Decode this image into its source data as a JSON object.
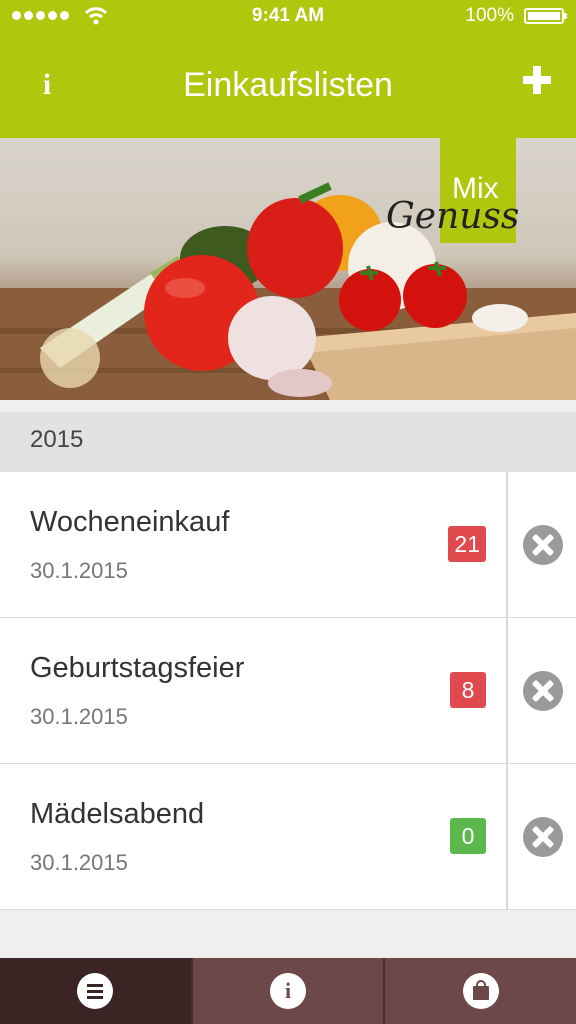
{
  "status_bar": {
    "time": "9:41 AM",
    "battery": "100%",
    "signal_icon": "signal-dots-icon",
    "wifi_icon": "wifi-icon",
    "battery_icon": "battery-icon"
  },
  "nav": {
    "title": "Einkaufslisten",
    "info_glyph": "i",
    "info_icon": "info-icon",
    "add_icon": "plus-icon"
  },
  "banner": {
    "logo_mix": "Mix",
    "logo_genuss": "Genuss"
  },
  "section": {
    "year": "2015"
  },
  "lists": [
    {
      "title": "Wocheneinkauf",
      "date": "30.1.2015",
      "count": "21",
      "badge_color": "#e04a4f"
    },
    {
      "title": "Geburtstagsfeier",
      "date": "30.1.2015",
      "count": "8",
      "badge_color": "#e04a4f"
    },
    {
      "title": "Mädelsabend",
      "date": "30.1.2015",
      "count": "0",
      "badge_color": "#5cb84d"
    }
  ],
  "tabbar": {
    "tabs": [
      {
        "icon": "list-icon",
        "active": true
      },
      {
        "icon": "info-icon",
        "glyph": "i",
        "active": false
      },
      {
        "icon": "shopping-bag-icon",
        "active": false
      }
    ]
  },
  "colors": {
    "accent": "#afc80d",
    "tabbar": "#6c4848",
    "tabbar_active": "#3a2424"
  }
}
